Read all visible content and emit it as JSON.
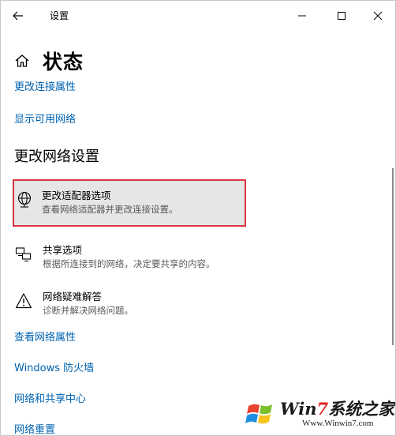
{
  "window": {
    "title": "设置"
  },
  "header": {
    "title": "状态"
  },
  "links_top": [
    {
      "label": "更改连接属性"
    },
    {
      "label": "显示可用网络"
    }
  ],
  "section": {
    "title": "更改网络设置"
  },
  "options": [
    {
      "title": "更改适配器选项",
      "desc": "查看网络适配器并更改连接设置。",
      "icon": "globe-network-icon"
    },
    {
      "title": "共享选项",
      "desc": "根据所连接到的网络，决定要共享的内容。",
      "icon": "sharing-icon"
    },
    {
      "title": "网络疑难解答",
      "desc": "诊断并解决网络问题。",
      "icon": "warning-icon"
    }
  ],
  "links_bottom": [
    {
      "label": "查看网络属性"
    },
    {
      "label": "Windows 防火墙"
    },
    {
      "label": "网络和共享中心"
    },
    {
      "label": "网络重置"
    }
  ],
  "watermark": {
    "brand_prefix": "Win",
    "brand_seven": "7",
    "brand_suffix": "系统之家",
    "url": "Www.Winwin7.com"
  },
  "colors": {
    "link": "#0063b1",
    "highlight_border": "#d9363e",
    "highlight_bg": "#e6e6e6"
  }
}
